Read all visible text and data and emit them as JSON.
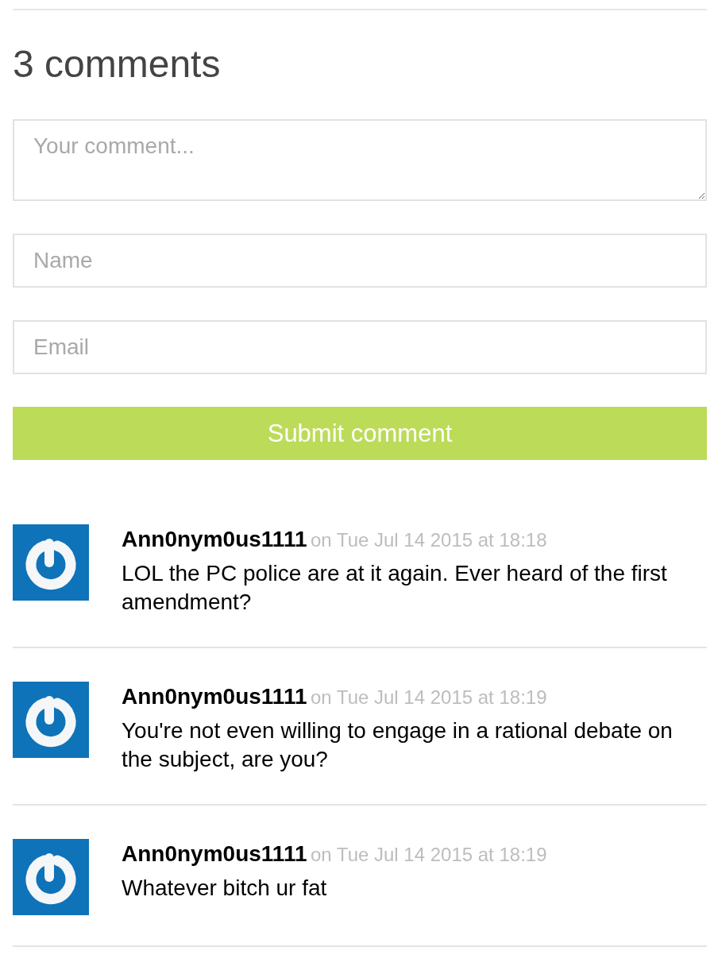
{
  "heading": "3 comments",
  "form": {
    "fields": [
      {
        "kind": "textarea",
        "placeholder": "Your comment..."
      },
      {
        "kind": "text",
        "placeholder": "Name"
      },
      {
        "kind": "text",
        "placeholder": "Email"
      }
    ],
    "submit_button": "Submit comment"
  },
  "comments": [
    {
      "author": "Ann0nym0us1111",
      "timestamp": "on Tue Jul 14 2015 at 18:18",
      "body": "LOL the PC police are at it again. Ever heard of the first amendment?"
    },
    {
      "author": "Ann0nym0us1111",
      "timestamp": "on Tue Jul 14 2015 at 18:19",
      "body": "You're not even willing to engage in a rational debate on the subject, are you?"
    },
    {
      "author": "Ann0nym0us1111",
      "timestamp": "on Tue Jul 14 2015 at 18:19",
      "body": "Whatever bitch ur fat"
    }
  ]
}
